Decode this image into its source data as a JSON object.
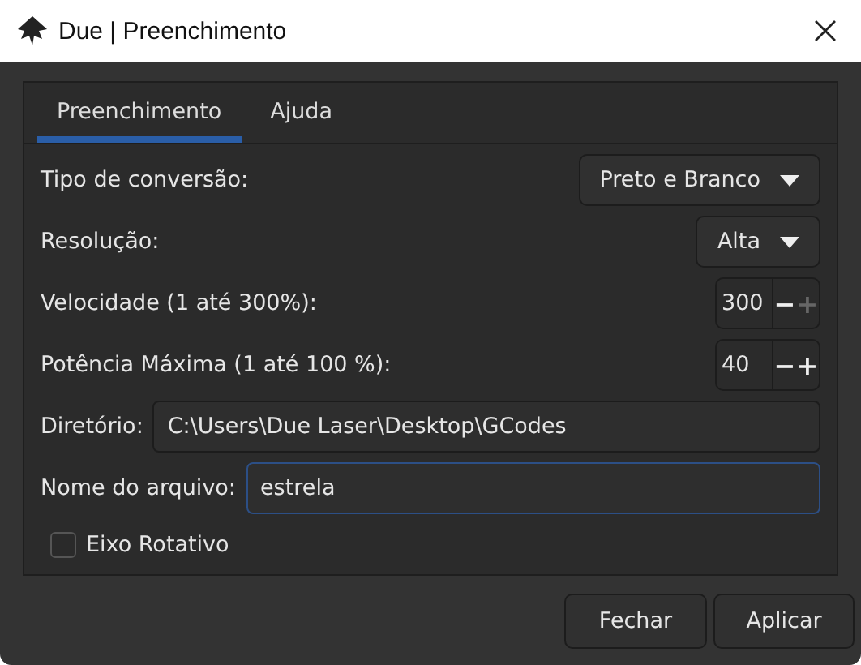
{
  "window": {
    "title": "Due | Preenchimento"
  },
  "tabs": [
    {
      "label": "Preenchimento",
      "selected": true
    },
    {
      "label": "Ajuda",
      "selected": false
    }
  ],
  "rows": [
    {
      "kind": "dropdown",
      "label": "Tipo de conversão:",
      "value": "Preto e Branco"
    },
    {
      "kind": "dropdown",
      "label": "Resolução:",
      "value": "Alta"
    },
    {
      "kind": "spin",
      "label": "Velocidade (1 até 300%):",
      "value": "300",
      "minus": "−",
      "plus": "+",
      "plus_disabled": true
    },
    {
      "kind": "spin",
      "label": "Potência Máxima (1 até 100 %):",
      "value": "40",
      "minus": "−",
      "plus": "+",
      "plus_disabled": false
    },
    {
      "kind": "field",
      "label": "Diretório:",
      "value": "C:\\Users\\Due Laser\\Desktop\\GCodes",
      "focused": false
    },
    {
      "kind": "field",
      "label": "Nome do arquivo:",
      "value": "estrela",
      "focused": true
    },
    {
      "kind": "checkbox",
      "label": "Eixo Rotativo",
      "checked": false
    }
  ],
  "buttons": [
    "Fechar",
    "Aplicar"
  ]
}
